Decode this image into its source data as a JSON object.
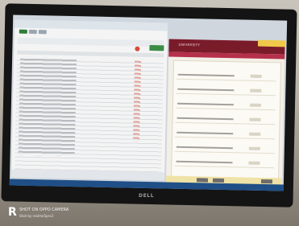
{
  "photo": {
    "subject": "Monitor",
    "monitor_brand": "DELL",
    "watermark": {
      "logo": "R",
      "line1": "SHOT ON OPPO CAMERA",
      "line2": "Shot by realme5pro3"
    },
    "colors": {
      "portal_header": "#7a1b2a",
      "taskbar": "#1f4f86",
      "sticker": "#f0c84a",
      "spreadsheet_accent": "#2f7d3a"
    },
    "screen": {
      "left_window": "spreadsheet",
      "right_window": "web portal",
      "portal_brand": "UNIVERSITY",
      "portal_rows": 7
    }
  }
}
